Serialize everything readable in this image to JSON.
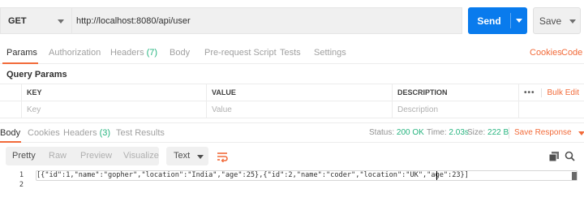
{
  "request": {
    "method": "GET",
    "url": "http://localhost:8080/api/user",
    "send_label": "Send",
    "save_label": "Save"
  },
  "request_tabs": {
    "params": "Params",
    "authorization": "Authorization",
    "headers": "Headers",
    "headers_count": "(7)",
    "body": "Body",
    "pre_request": "Pre-request Script",
    "tests": "Tests",
    "settings": "Settings",
    "cookies": "Cookies",
    "code": "Code"
  },
  "query_params": {
    "title": "Query Params",
    "columns": {
      "key": "KEY",
      "value": "VALUE",
      "description": "DESCRIPTION"
    },
    "more_label": "•••",
    "bulk_edit": "Bulk Edit",
    "placeholders": {
      "key": "Key",
      "value": "Value",
      "description": "Description"
    }
  },
  "response_tabs": {
    "body": "Body",
    "cookies": "Cookies",
    "headers": "Headers",
    "headers_count": "(3)",
    "test_results": "Test Results"
  },
  "response_status": {
    "status_label": "Status:",
    "status_value": "200 OK",
    "time_label": "Time:",
    "time_value": "2.03s",
    "size_label": "Size:",
    "size_value": "222 B",
    "save_response": "Save Response"
  },
  "view_modes": {
    "pretty": "Pretty",
    "raw": "Raw",
    "preview": "Preview",
    "visualize": "Visualize",
    "format": "Text"
  },
  "code_lines": [
    {
      "num": "1",
      "text": "[{\"id\":1,\"name\":\"gopher\",\"location\":\"India\",\"age\":25},{\"id\":2,\"name\":\"coder\",\"location\":\"UK\",\"age\":23}]"
    },
    {
      "num": "2",
      "text": ""
    }
  ],
  "icons": {
    "method_dropdown": "chevron-down-icon",
    "send_dropdown": "chevron-down-icon",
    "wrap": "wrap-lines-icon",
    "copy": "copy-icon",
    "search": "search-icon"
  },
  "colors": {
    "accent": "#f26b3a",
    "send": "#097bed",
    "success": "#26b47f"
  }
}
